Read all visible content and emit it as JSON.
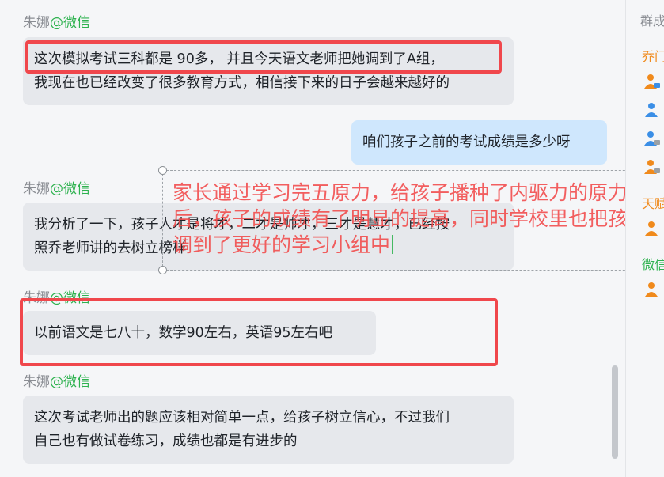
{
  "chat": {
    "messages": [
      {
        "sender": "朱娜",
        "source": "@微信",
        "lines": [
          "这次模拟考试三科都是 90多， 并且今天语文老师把她调到了A组，",
          "我现在也已经改变了很多教育方式，相信接下来的日子会越来越好的"
        ]
      },
      {
        "sender": "",
        "source": "",
        "lines": [
          "咱们孩子之前的考试成绩是多少呀"
        ],
        "self": true
      },
      {
        "sender": "朱娜",
        "source": "@微信",
        "lines": [
          "我分析了一下，孩子人才是将才，二才是帅才，三才是慧才，已经按",
          "照乔老师讲的去树立榜样"
        ]
      },
      {
        "sender": "朱娜",
        "source": "@微信",
        "lines": [
          "以前语文是七八十，数学90左右，英语95左右吧"
        ]
      },
      {
        "sender": "朱娜",
        "source": "@微信",
        "lines": [
          "这次考试老师出的题应该相对简单一点，给孩子树立信心，不过我们",
          "自己也有做试卷练习，成绩也都是有进步的"
        ]
      }
    ]
  },
  "annotation": {
    "text": "家长通过学习完五原力，给孩子播种了内驱力的原力之后，孩子的成绩有了明显的提高，同时学校里也把孩子调到了更好的学习小组中",
    "color": "#f24a4a"
  },
  "highlight_color": "#f0474c",
  "group_panel": {
    "title": "群成",
    "sections": [
      {
        "label": "乔门",
        "color": "#f08a1c"
      },
      {
        "label": "天赋",
        "color": "#f08a1c"
      },
      {
        "label": "微信",
        "color": "#2eb24f"
      }
    ],
    "member_icons": [
      "person-icon"
    ]
  }
}
